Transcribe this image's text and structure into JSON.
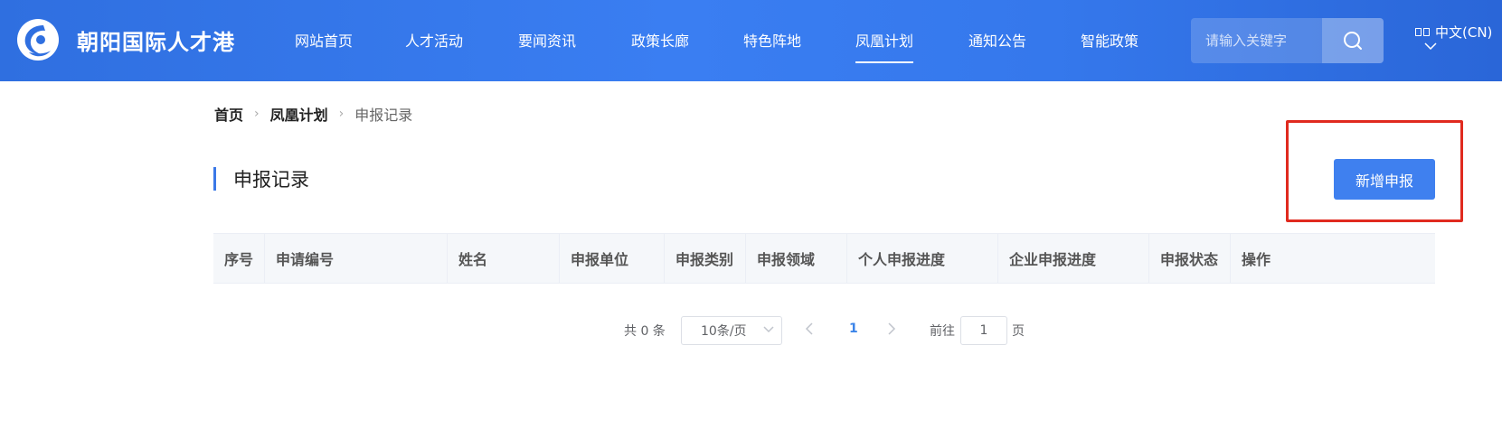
{
  "header": {
    "site_title": "朝阳国际人才港",
    "nav": [
      {
        "label": "网站首页",
        "active": false
      },
      {
        "label": "人才活动",
        "active": false
      },
      {
        "label": "要闻资讯",
        "active": false
      },
      {
        "label": "政策长廊",
        "active": false
      },
      {
        "label": "特色阵地",
        "active": false
      },
      {
        "label": "凤凰计划",
        "active": true
      },
      {
        "label": "通知公告",
        "active": false
      },
      {
        "label": "智能政策",
        "active": false
      }
    ],
    "search": {
      "placeholder": "请输入关键字",
      "icon": "search-icon"
    },
    "language": {
      "label": "中文(CN)",
      "icon": "language-icon"
    }
  },
  "breadcrumb": {
    "items": [
      "首页",
      "凤凰计划"
    ],
    "current": "申报记录"
  },
  "main": {
    "title": "申报记录",
    "add_button": "新增申报",
    "accent_color": "#3f80ef",
    "highlight_color": "#e02a1f"
  },
  "table": {
    "columns": [
      "序号",
      "申请编号",
      "姓名",
      "申报单位",
      "申报类别",
      "申报领域",
      "个人申报进度",
      "企业申报进度",
      "申报状态",
      "操作"
    ],
    "rows": []
  },
  "pagination": {
    "total_text": "共 0 条",
    "page_size": "10条/页",
    "current_page": "1",
    "goto_label": "前往",
    "goto_value": "1",
    "page_suffix": "页"
  }
}
